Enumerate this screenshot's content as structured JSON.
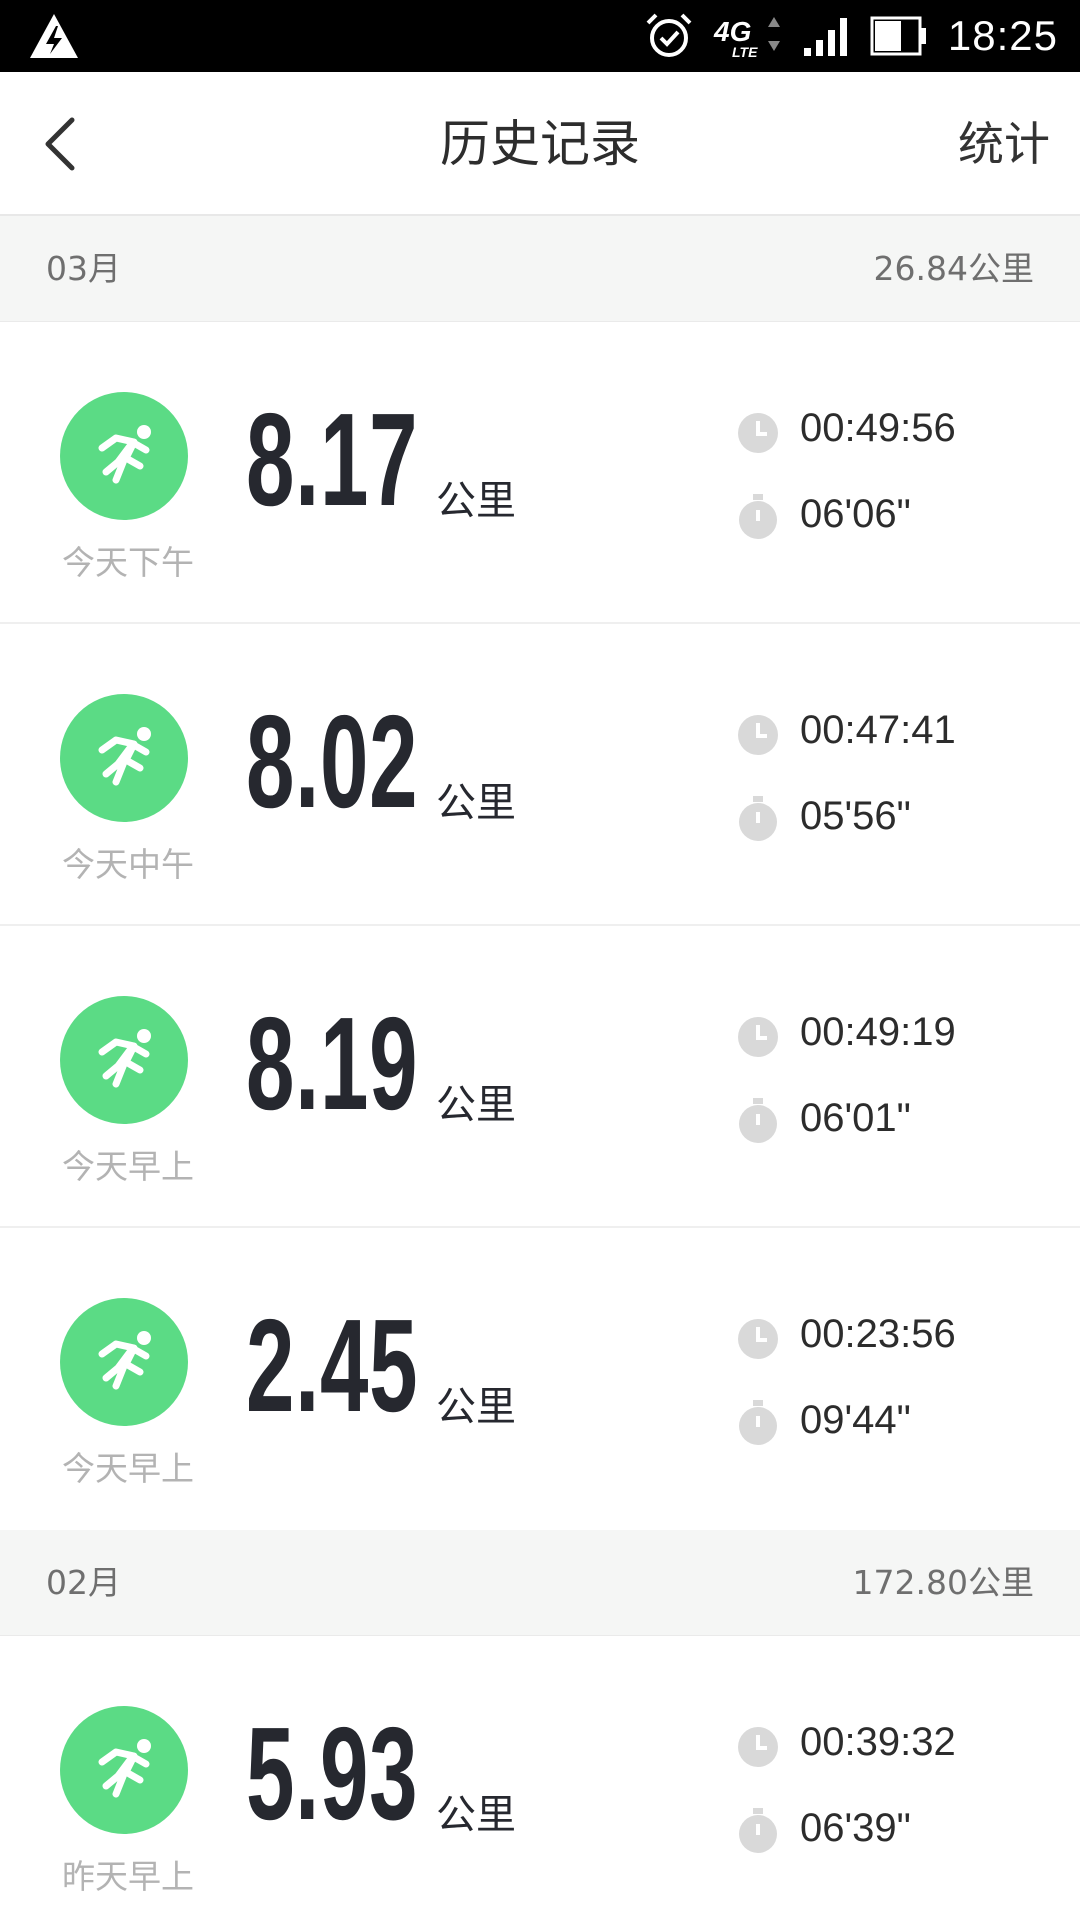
{
  "status_bar": {
    "time": "18:25",
    "network": "4G",
    "network_sub": "LTE",
    "icons": [
      "charging-icon",
      "alarm-icon",
      "network-4g-icon",
      "signal-icon",
      "battery-icon"
    ]
  },
  "nav": {
    "title": "历史记录",
    "right_action": "统计",
    "back_icon": "chevron-left-icon"
  },
  "sections": [
    {
      "month": "03月",
      "total": "26.84公里",
      "runs": [
        {
          "when": "今天下午",
          "distance": "8.17",
          "unit": "公里",
          "duration": "00:49:56",
          "pace": "06'06\""
        },
        {
          "when": "今天中午",
          "distance": "8.02",
          "unit": "公里",
          "duration": "00:47:41",
          "pace": "05'56\""
        },
        {
          "when": "今天早上",
          "distance": "8.19",
          "unit": "公里",
          "duration": "00:49:19",
          "pace": "06'01\""
        },
        {
          "when": "今天早上",
          "distance": "2.45",
          "unit": "公里",
          "duration": "00:23:56",
          "pace": "09'44\""
        }
      ]
    },
    {
      "month": "02月",
      "total": "172.80公里",
      "runs": [
        {
          "when": "昨天早上",
          "distance": "5.93",
          "unit": "公里",
          "duration": "00:39:32",
          "pace": "06'39\""
        }
      ]
    }
  ],
  "colors": {
    "accent_green": "#5bdb85",
    "number_dark": "#26282f",
    "section_bg": "#f5f6f5",
    "muted_text": "#b3b3b3"
  }
}
